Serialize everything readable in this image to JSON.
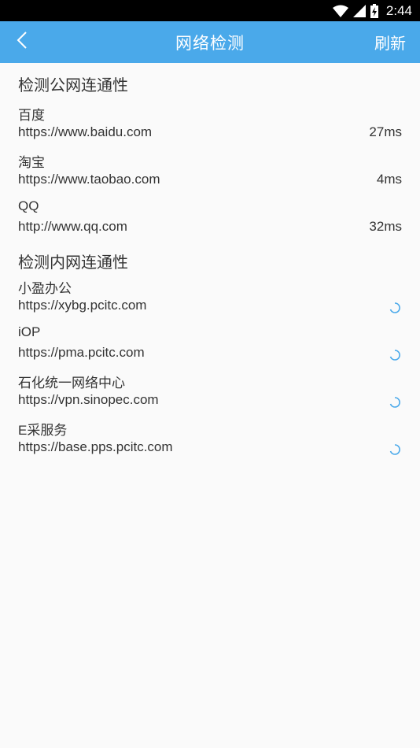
{
  "status_bar": {
    "time": "2:44"
  },
  "app_bar": {
    "title": "网络检测",
    "refresh_label": "刷新"
  },
  "public_section": {
    "title": "检测公网连通性",
    "items": [
      {
        "name": "百度",
        "url": "https://www.baidu.com",
        "latency": "27ms"
      },
      {
        "name": "淘宝",
        "url": "https://www.taobao.com",
        "latency": "4ms"
      },
      {
        "name": "QQ",
        "url": "http://www.qq.com",
        "latency": "32ms"
      }
    ]
  },
  "internal_section": {
    "title": "检测内网连通性",
    "items": [
      {
        "name": "小盈办公",
        "url": "https://xybg.pcitc.com",
        "status": "loading"
      },
      {
        "name": "iOP",
        "url": "https://pma.pcitc.com",
        "status": "loading"
      },
      {
        "name": "石化统一网络中心",
        "url": "https://vpn.sinopec.com",
        "status": "loading"
      },
      {
        "name": "E采服务",
        "url": "https://base.pps.pcitc.com",
        "status": "loading"
      }
    ]
  },
  "colors": {
    "accent": "#4aa9ea",
    "background": "#fafafa",
    "text": "#333333"
  }
}
